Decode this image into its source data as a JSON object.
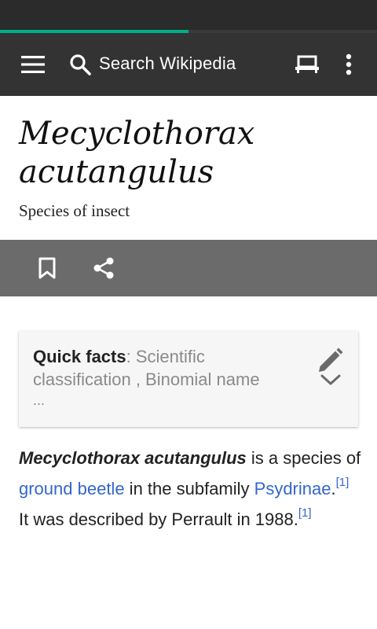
{
  "status_bar": {},
  "progress": {
    "fraction": 0.5
  },
  "toolbar": {
    "search_placeholder": "Search Wikipedia",
    "icons": {
      "menu": "hamburger-menu-icon",
      "search": "search-icon",
      "tabs": "tabs-icon",
      "overflow": "more-vert-icon"
    }
  },
  "article": {
    "title": "Mecyclothorax acutangulus",
    "description": "Species of insect"
  },
  "action_bar": {
    "icons": {
      "bookmark": "bookmark-icon",
      "share": "share-icon"
    }
  },
  "quick_facts": {
    "label": "Quick facts",
    "separator": ": ",
    "items": "Scientific classification , Binomial name",
    "ellipsis": "..."
  },
  "body": {
    "name": "Mecyclothorax acutangulus",
    "text1": " is a species of ",
    "link1": "ground beetle",
    "text2": " in the subfamily ",
    "link2": "Psydrinae",
    "text3": ".",
    "ref1": "[1]",
    "text4": " It was described by Perrault in 1988.",
    "ref2": "[1]"
  },
  "colors": {
    "toolbar_bg": "#333333",
    "status_bg": "#2b2b2b",
    "progress": "#00af89",
    "action_bar_bg": "#6b6b6b",
    "link": "#3366cc"
  }
}
